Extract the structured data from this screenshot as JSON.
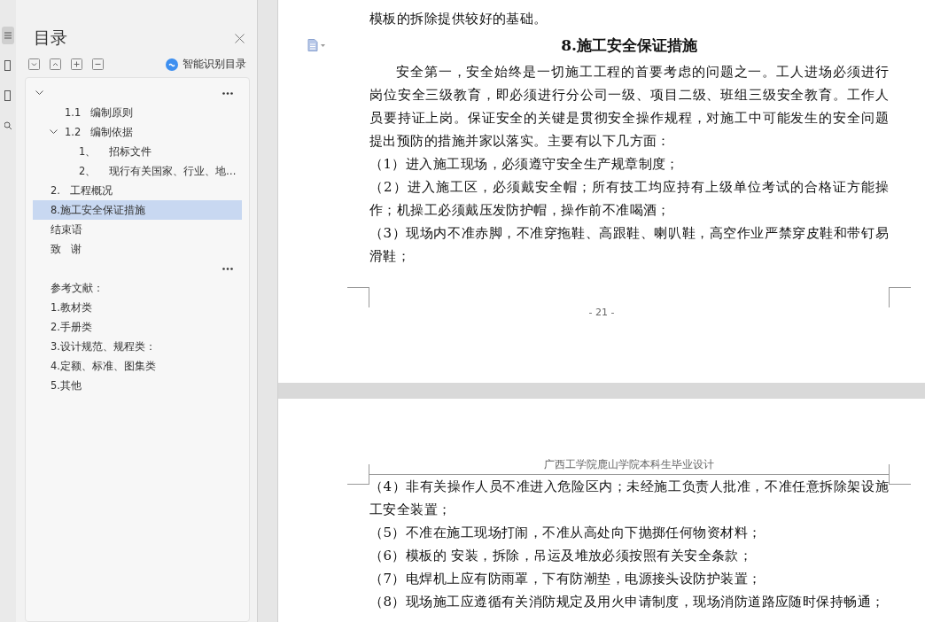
{
  "toc_panel": {
    "title": "目录",
    "smart_button": "智能识别目录",
    "groups": [
      {
        "items": [
          {
            "expanded": true,
            "selected": false,
            "children": [
              {
                "label": "1.1   编制原则",
                "selected": false
              },
              {
                "label": "1.2   编制依据",
                "expanded": true,
                "selected": false,
                "children": [
                  {
                    "label": "1、    招标文件",
                    "selected": false
                  },
                  {
                    "label": "2、    现行有关国家、行业、地…",
                    "selected": false
                  }
                ]
              }
            ]
          },
          {
            "label": "2.   工程概况",
            "selected": false
          },
          {
            "label": "8.施工安全保证措施",
            "selected": true
          },
          {
            "label": "结束语",
            "selected": false
          },
          {
            "label": "致   谢",
            "selected": false
          }
        ]
      },
      {
        "items": [
          {
            "label": "参考文献：",
            "selected": false
          },
          {
            "label": "1.教材类",
            "selected": false
          },
          {
            "label": "2.手册类",
            "selected": false
          },
          {
            "label": "3.设计规范、规程类：",
            "selected": false
          },
          {
            "label": "4.定额、标准、图集类",
            "selected": false
          },
          {
            "label": "5.其他",
            "selected": false
          }
        ]
      }
    ]
  },
  "document": {
    "pages": [
      {
        "paragraphs": [
          {
            "kind": "plain",
            "text": "模板的拆除提供较好的基础。"
          },
          {
            "kind": "heading",
            "text": "8.施工安全保证措施"
          },
          {
            "kind": "indent",
            "text": "安全第一，安全始终是一切施工工程的首要考虑的问题之一。工人进场必须进行岗位安全三级教育，即必须进行分公司一级、项目二级、班组三级安全教育。工作人员要持证上岗。保证安全的关键是贯彻安全操作规程，对施工中可能发生的安全问题提出预防的措施并家以落实。主要有以下几方面："
          },
          {
            "kind": "plain",
            "text": "（1）进入施工现场，必须遵守安全生产规章制度；"
          },
          {
            "kind": "plain",
            "text": "（2）进入施工区，必须戴安全帽；所有技工均应持有上级单位考试的合格证方能操作；机操工必须戴压发防护帽，操作前不准喝酒；"
          },
          {
            "kind": "plain",
            "text": "（3）现场内不准赤脚，不准穿拖鞋、高跟鞋、喇叭鞋，高空作业严禁穿皮鞋和带钉易滑鞋；"
          }
        ],
        "page_number": "- 21 -"
      },
      {
        "header": "广西工学院鹿山学院本科生毕业设计",
        "paragraphs": [
          {
            "kind": "plain",
            "text": "（4）非有关操作人员不准进入危险区内；未经施工负责人批准，不准任意拆除架设施工安全装置；"
          },
          {
            "kind": "plain",
            "text": "（5）不准在施工现场打闹，不准从高处向下抛掷任何物资材料；"
          },
          {
            "kind": "plain",
            "text": "（6）模板的 安装，拆除，吊运及堆放必须按照有关安全条款；"
          },
          {
            "kind": "plain",
            "text": "（7）电焊机上应有防雨罩，下有防潮垫，电源接头设防护装置；"
          },
          {
            "kind": "plain",
            "text": "（8）现场施工应遵循有关消防规定及用火申请制度，现场消防道路应随时保持畅通；"
          }
        ]
      }
    ]
  }
}
